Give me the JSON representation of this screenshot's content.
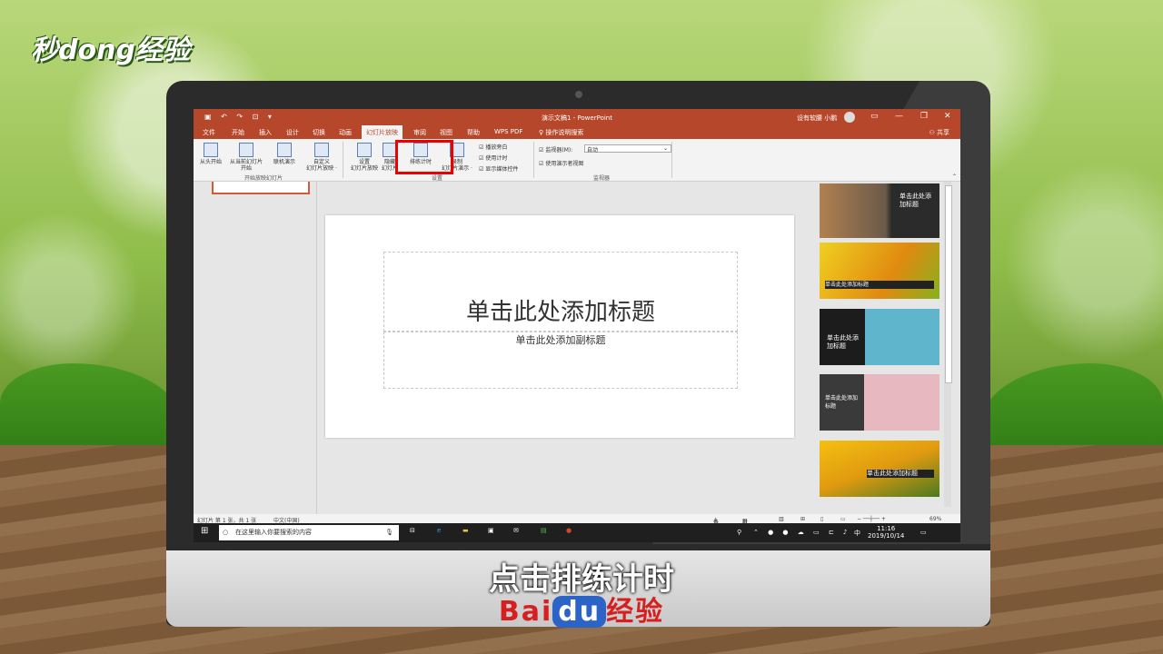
{
  "watermark": {
    "brand_top": "秒dong经验",
    "caption": "点击排练计时",
    "bottom_brand_left": "Bai",
    "bottom_brand_badge": "du",
    "bottom_brand_right": "经验"
  },
  "window": {
    "title": "演示文稿1 - PowerPoint",
    "user": "设有软腰 小鹏",
    "share": "共享"
  },
  "tabs": [
    "文件",
    "开始",
    "插入",
    "设计",
    "切换",
    "动画",
    "幻灯片放映",
    "审阅",
    "视图",
    "帮助",
    "WPS PDF",
    "操作说明搜索"
  ],
  "ribbon": {
    "b1": "从头开始",
    "b2a": "从当前幻灯片",
    "b2b": "开始",
    "b3": "联机演示",
    "b4a": "自定义",
    "b4b": "幻灯片放映 ·",
    "g1": "开始放映幻灯片",
    "b5a": "设置",
    "b5b": "幻灯片放映",
    "b6a": "隐藏",
    "b6b": "幻灯片",
    "b7": "排练计时",
    "b8a": "录制",
    "b8b": "幻灯片演示 ·",
    "cb1": "播放旁白",
    "cb2": "使用计时",
    "cb3": "显示媒体控件",
    "g2": "设置",
    "monitor_label": "监视器(M):",
    "monitor_value": "自动",
    "cb4": "使用演示者视图",
    "g3": "监视器"
  },
  "slide": {
    "title_placeholder": "单击此处添加标题",
    "subtitle_placeholder": "单击此处添加副标题"
  },
  "designs": [
    {
      "label": "单击此处添加标题"
    },
    {
      "label": "单击此处添加标题"
    },
    {
      "label": "单击此处添加标题"
    },
    {
      "label": "单击此处添加标题"
    },
    {
      "label": "单击此处添加标题"
    }
  ],
  "status": {
    "slide_info": "幻灯片 第 1 张，共 1 张",
    "lang": "中文(中国)",
    "notes": "备注",
    "comments": "批注",
    "zoom": "69%"
  },
  "taskbar": {
    "search_placeholder": "在这里输入你要搜索的内容",
    "ime": "中",
    "time": "11:16",
    "date": "2019/10/14"
  },
  "colors": {
    "accent": "#b7472a",
    "highlight": "#e00000"
  }
}
